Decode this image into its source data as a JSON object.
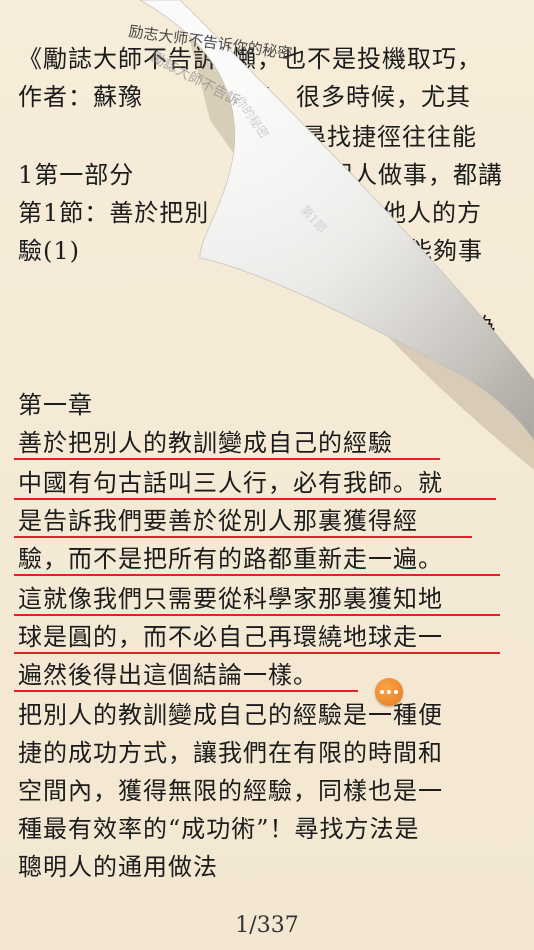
{
  "curl_title": "励志大师不告诉你的秘密",
  "top_lines": [
    "《勵誌大師不告訴",
    "作者：蘇豫",
    "",
    "1第一部分",
    "第1節：善於把別",
    "驗(1)"
  ],
  "top_right_fragments": [
    "懶，也不是投機取巧，",
    "率。很多時候，尤其",
    "尋找捷徑往往能",
    "明人做事，都講",
    "運用他人的方",
    "往往能夠事",
    "",
    "加多為"
  ],
  "chapter": "第一章",
  "underlined_lines": [
    "善於把別人的教訓變成自己的經驗",
    "中國有句古話叫三人行，必有我師。就",
    "是告訴我們要善於從別人那裏獲得經",
    "驗，而不是把所有的路都重新走一遍。",
    "這就像我們只需要從科學家那裏獲知地",
    "球是圓的，而不必自己再環繞地球走一",
    "遍然後得出這個結論一樣。"
  ],
  "body_lines": [
    "把別人的教訓變成自己的經驗是一種便",
    "捷的成功方式，讓我們在有限的時間和",
    "空間內，獲得無限的經驗，同樣也是一",
    "種最有效率的“成功術”！尋找方法是",
    "聰明人的通用做法"
  ],
  "page_indicator": "1/337",
  "colors": {
    "paper": "#f5ead6",
    "underline": "#e0222a",
    "note_button": "#ef8a2a"
  },
  "icons": {
    "note_button": "ellipsis-icon"
  }
}
